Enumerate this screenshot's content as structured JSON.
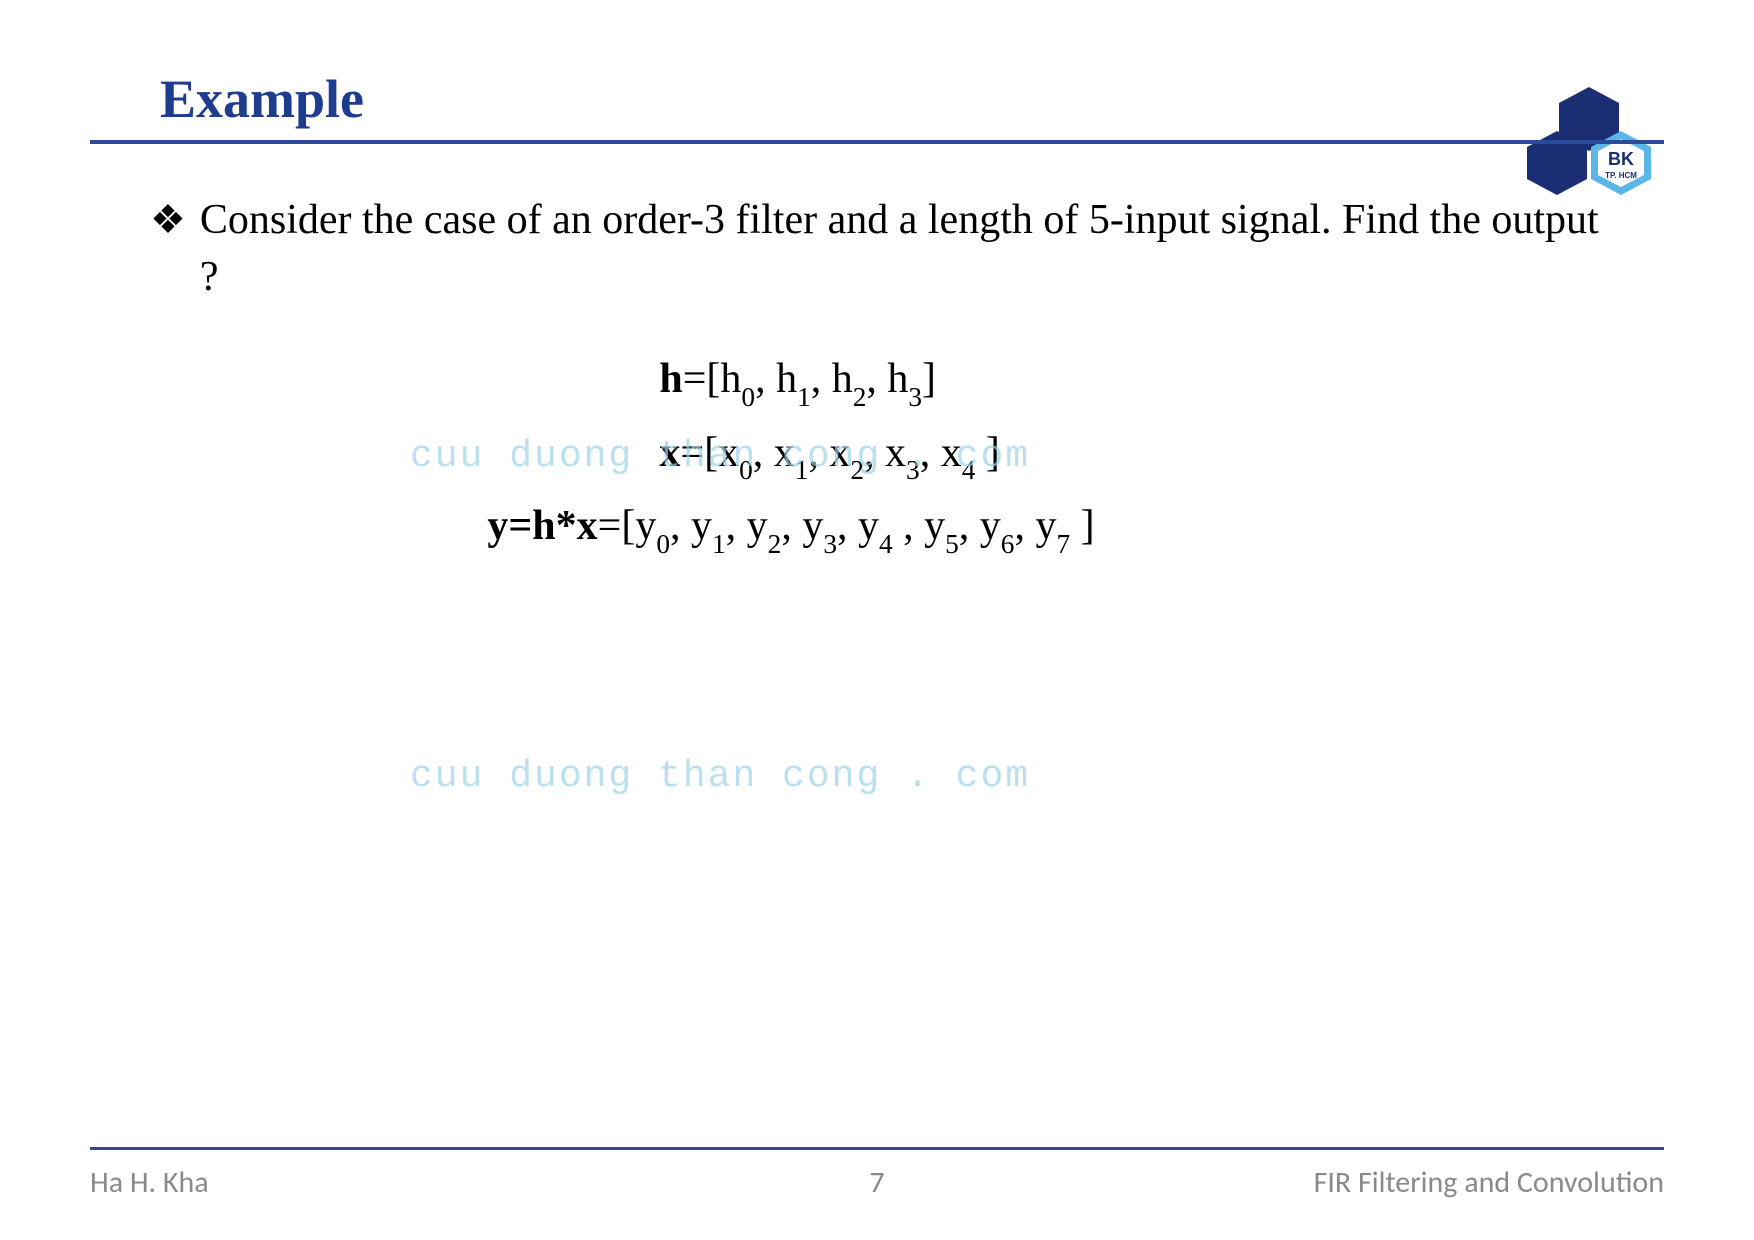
{
  "header": {
    "title": "Example",
    "logo": {
      "top_text": "BK",
      "bottom_text": "TP. HCM"
    }
  },
  "content": {
    "bullet_symbol": "❖",
    "bullet_text": "Consider the case of an order-3 filter and a length of 5-input signal. Find the output ?",
    "equations": {
      "h": {
        "var": "h",
        "eq": "=",
        "open": "[",
        "items": [
          "h₀",
          "h₁",
          "h₂",
          "h₃"
        ],
        "close": "]"
      },
      "x": {
        "var": "x",
        "eq": "=",
        "open": "[",
        "items": [
          "x₀",
          "x₁",
          "x₂",
          "x₃",
          "x₄"
        ],
        "close": " ]"
      },
      "y": {
        "lhs": "y=h*x",
        "eq": "=",
        "open": "[",
        "items": [
          "y₀",
          "y₁",
          "y₂",
          "y₃",
          "y₄ ",
          "y₅",
          "y₆",
          "y₇"
        ],
        "close": " ]"
      }
    }
  },
  "watermark": "cuu duong than cong . com",
  "footer": {
    "left": "Ha H. Kha",
    "center": "7",
    "right": "FIR Filtering and Convolution"
  },
  "colors": {
    "title": "#1f3d8f",
    "rule": "#2b4a9a",
    "watermark": "#9fd3e6",
    "footer": "#8a8a8a"
  }
}
